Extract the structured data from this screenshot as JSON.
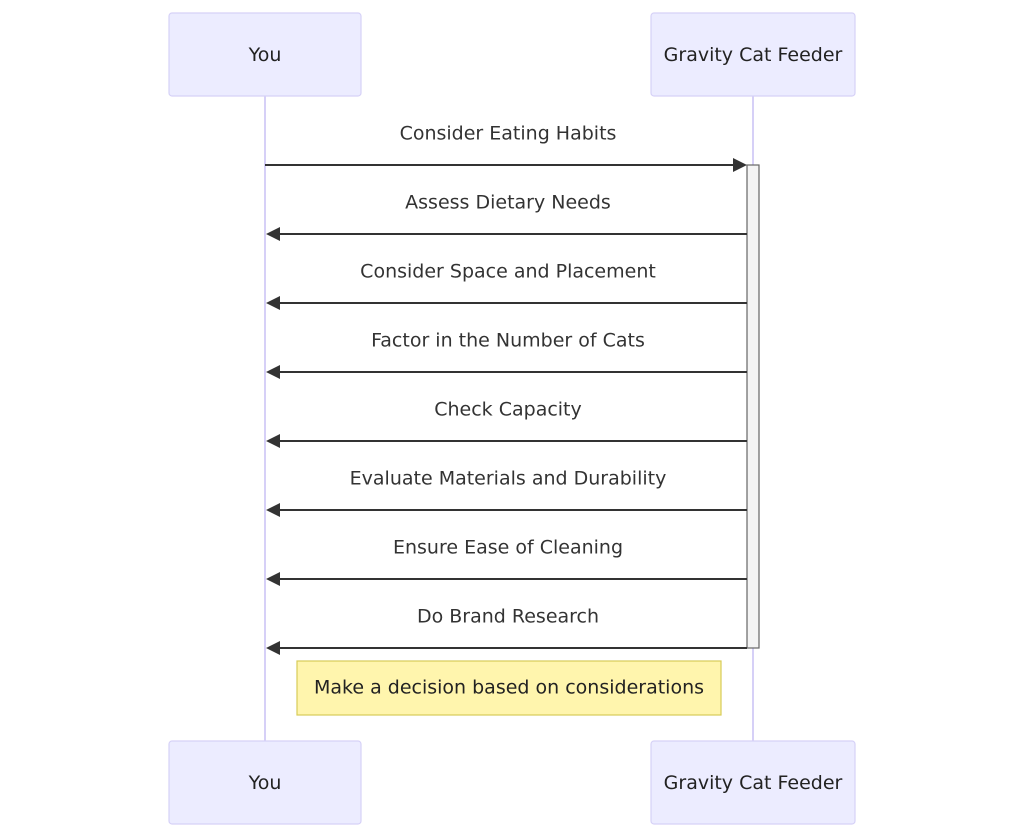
{
  "diagram": {
    "type": "sequence",
    "participants": [
      {
        "id": "you",
        "label": "You"
      },
      {
        "id": "feeder",
        "label": "Gravity Cat Feeder"
      }
    ],
    "messages": [
      {
        "from": "you",
        "to": "feeder",
        "label": "Consider Eating Habits"
      },
      {
        "from": "feeder",
        "to": "you",
        "label": "Assess Dietary Needs"
      },
      {
        "from": "feeder",
        "to": "you",
        "label": "Consider Space and Placement"
      },
      {
        "from": "feeder",
        "to": "you",
        "label": "Factor in the Number of Cats"
      },
      {
        "from": "feeder",
        "to": "you",
        "label": "Check Capacity"
      },
      {
        "from": "feeder",
        "to": "you",
        "label": "Evaluate Materials and Durability"
      },
      {
        "from": "feeder",
        "to": "you",
        "label": "Ensure Ease of Cleaning"
      },
      {
        "from": "feeder",
        "to": "you",
        "label": "Do Brand Research"
      }
    ],
    "activation": {
      "participant": "feeder",
      "from_message": 0,
      "to_message": 7
    },
    "note": {
      "over": [
        "you",
        "feeder"
      ],
      "label": "Make a decision based on considerations"
    },
    "colors": {
      "actor_fill": "#ececff",
      "actor_stroke": "#d6d1f7",
      "lifeline": "#d6d0f7",
      "message": "#333333",
      "note_fill": "#fff5ad",
      "note_stroke": "#d7cc58",
      "activation_fill": "#f4f4f4"
    }
  }
}
